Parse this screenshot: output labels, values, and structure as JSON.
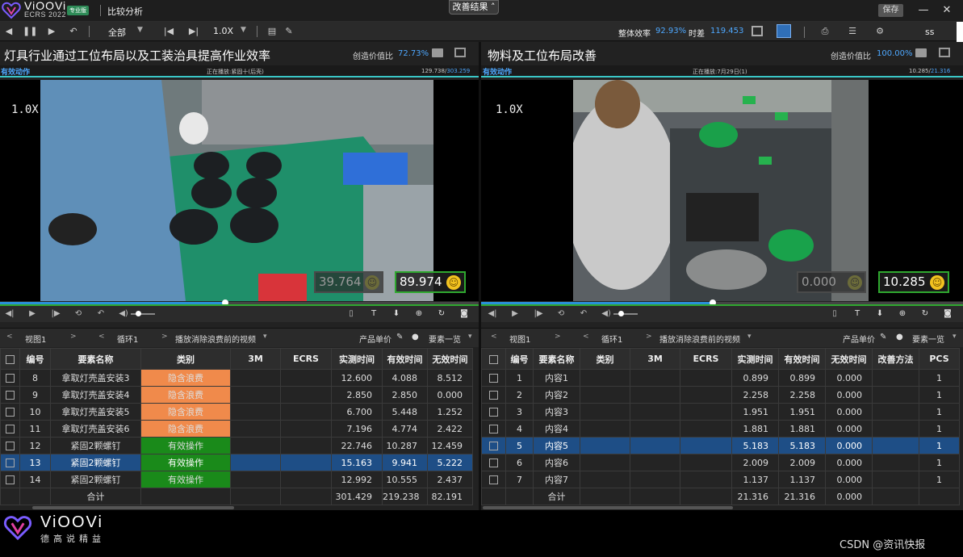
{
  "app": {
    "brand": "ViOOVi",
    "version": "ECRS 2022",
    "edition": "专业版",
    "title": "比较分析",
    "improve_results": "改善结果",
    "save": "保存"
  },
  "toolbar": {
    "all": "全部",
    "speed": "1.0X",
    "overall_eff_label": "整体效率",
    "overall_eff_value": "92.93%",
    "time_diff_label": "时差",
    "time_diff_value": "119.453",
    "user": "ss"
  },
  "left": {
    "title": "灯具行业通过工位布局以及工装治具提高作业效率",
    "create_label": "创造价值比",
    "create_value": "72.73%",
    "eff_action": "有效动作",
    "playing": "正在播放:紧固十(后壳)",
    "time_current": "129.738/",
    "time_total": "303.259",
    "speed_overlay": "1.0X",
    "score_dim": "39.764",
    "score": "89.974",
    "progress": 0.47,
    "view": "视图1",
    "loop": "循环1",
    "play_mode": "播放消除浪费前的视频",
    "unit_price": "产品单价",
    "element_list": "要素一览",
    "headers": [
      "编号",
      "要素名称",
      "类别",
      "3M",
      "ECRS",
      "实测时间",
      "有效时间",
      "无效时间"
    ],
    "rows": [
      {
        "no": "8",
        "name": "拿取灯壳盖安装3",
        "cat": "隐含浪费",
        "catType": "orange",
        "m3": "",
        "ecrs": "",
        "meas": "12.600",
        "eff": "4.088",
        "ineff": "8.512",
        "sel": false
      },
      {
        "no": "9",
        "name": "拿取灯壳盖安装4",
        "cat": "隐含浪费",
        "catType": "orange",
        "m3": "",
        "ecrs": "",
        "meas": "2.850",
        "eff": "2.850",
        "ineff": "0.000",
        "sel": false
      },
      {
        "no": "10",
        "name": "拿取灯壳盖安装5",
        "cat": "隐含浪费",
        "catType": "orange",
        "m3": "",
        "ecrs": "",
        "meas": "6.700",
        "eff": "5.448",
        "ineff": "1.252",
        "sel": false
      },
      {
        "no": "11",
        "name": "拿取灯壳盖安装6",
        "cat": "隐含浪费",
        "catType": "orange",
        "m3": "",
        "ecrs": "",
        "meas": "7.196",
        "eff": "4.774",
        "ineff": "2.422",
        "sel": false
      },
      {
        "no": "12",
        "name": "紧固2颗螺钉",
        "cat": "有效操作",
        "catType": "green",
        "m3": "",
        "ecrs": "",
        "meas": "22.746",
        "eff": "10.287",
        "ineff": "12.459",
        "sel": false
      },
      {
        "no": "13",
        "name": "紧固2颗螺钉",
        "cat": "有效操作",
        "catType": "green",
        "m3": "",
        "ecrs": "",
        "meas": "15.163",
        "eff": "9.941",
        "ineff": "5.222",
        "sel": true
      },
      {
        "no": "14",
        "name": "紧固2颗螺钉",
        "cat": "有效操作",
        "catType": "green",
        "m3": "",
        "ecrs": "",
        "meas": "12.992",
        "eff": "10.555",
        "ineff": "2.437",
        "sel": false
      }
    ],
    "total": {
      "label": "合计",
      "meas": "301.429",
      "eff": "219.238",
      "ineff": "82.191"
    }
  },
  "right": {
    "title": "物料及工位布局改善",
    "create_label": "创造价值比",
    "create_value": "100.00%",
    "eff_action": "有效动作",
    "playing": "正在播放:7月29日(1)",
    "time_current": "10.285/",
    "time_total": "21.316",
    "speed_overlay": "1.0X",
    "score_dim": "0.000",
    "score": "10.285",
    "progress": 0.48,
    "view": "视图1",
    "loop": "循环1",
    "play_mode": "播放消除浪费前的视频",
    "unit_price": "产品单价",
    "element_list": "要素一览",
    "headers": [
      "编号",
      "要素名称",
      "类别",
      "3M",
      "ECRS",
      "实测时间",
      "有效时间",
      "无效时间",
      "改善方法",
      "PCS"
    ],
    "rows": [
      {
        "no": "1",
        "name": "内容1",
        "meas": "0.899",
        "eff": "0.899",
        "ineff": "0.000",
        "pcs": "1",
        "sel": false
      },
      {
        "no": "2",
        "name": "内容2",
        "meas": "2.258",
        "eff": "2.258",
        "ineff": "0.000",
        "pcs": "1",
        "sel": false
      },
      {
        "no": "3",
        "name": "内容3",
        "meas": "1.951",
        "eff": "1.951",
        "ineff": "0.000",
        "pcs": "1",
        "sel": false
      },
      {
        "no": "4",
        "name": "内容4",
        "meas": "1.881",
        "eff": "1.881",
        "ineff": "0.000",
        "pcs": "1",
        "sel": false
      },
      {
        "no": "5",
        "name": "内容5",
        "meas": "5.183",
        "eff": "5.183",
        "ineff": "0.000",
        "pcs": "1",
        "sel": true
      },
      {
        "no": "6",
        "name": "内容6",
        "meas": "2.009",
        "eff": "2.009",
        "ineff": "0.000",
        "pcs": "1",
        "sel": false
      },
      {
        "no": "7",
        "name": "内容7",
        "meas": "1.137",
        "eff": "1.137",
        "ineff": "0.000",
        "pcs": "1",
        "sel": false
      }
    ],
    "total": {
      "label": "合计",
      "meas": "21.316",
      "eff": "21.316",
      "ineff": "0.000"
    }
  },
  "footer": {
    "brand": "ViOOVi",
    "slogan": "德高说精益",
    "watermark": "CSDN @资讯快报"
  },
  "colors": {
    "accent": "#4ea8ff",
    "waste": "#f08a4b",
    "effective": "#1a8a1a",
    "selected": "#1e4e86",
    "cyan_line": "#3ac7c7"
  }
}
